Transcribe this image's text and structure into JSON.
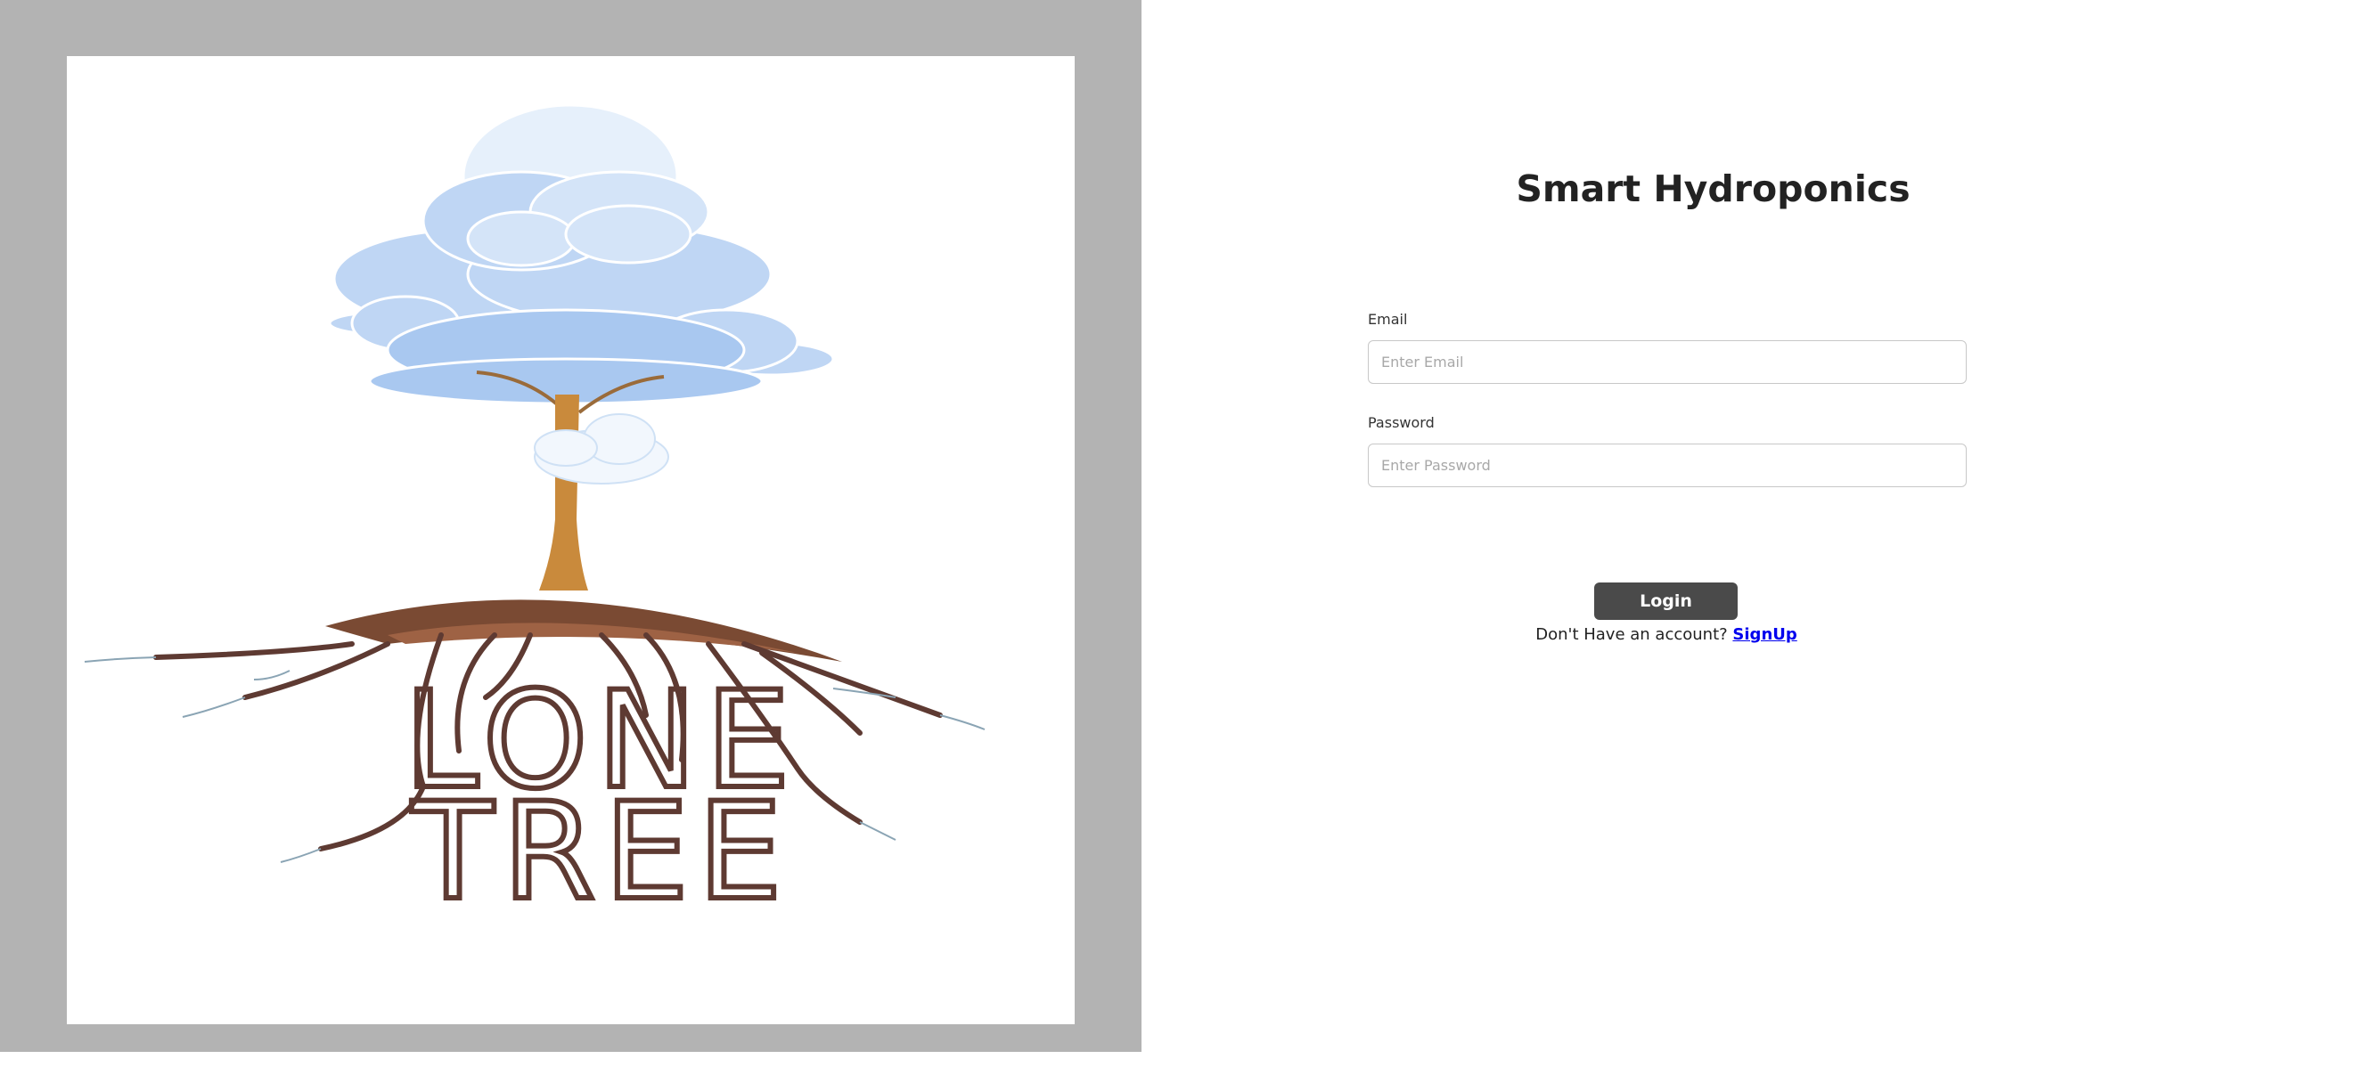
{
  "app": {
    "title": "Smart Hydroponics",
    "logo_text": "LONE TREE"
  },
  "form": {
    "email": {
      "label": "Email",
      "placeholder": "Enter Email",
      "value": ""
    },
    "password": {
      "label": "Password",
      "placeholder": "Enter Password",
      "value": ""
    },
    "login_label": "Login",
    "signup_prompt": "Don't Have an account?",
    "signup_link": "SignUp"
  },
  "colors": {
    "left_panel_bg": "#b3b3b3",
    "login_button_bg": "#4a4a4a",
    "link": "#0000ee",
    "cloud": "#a9c8f0",
    "trunk": "#c98a3c",
    "roots": "#6b3a2e"
  },
  "icons": {
    "logo": "lone-tree-logo"
  }
}
